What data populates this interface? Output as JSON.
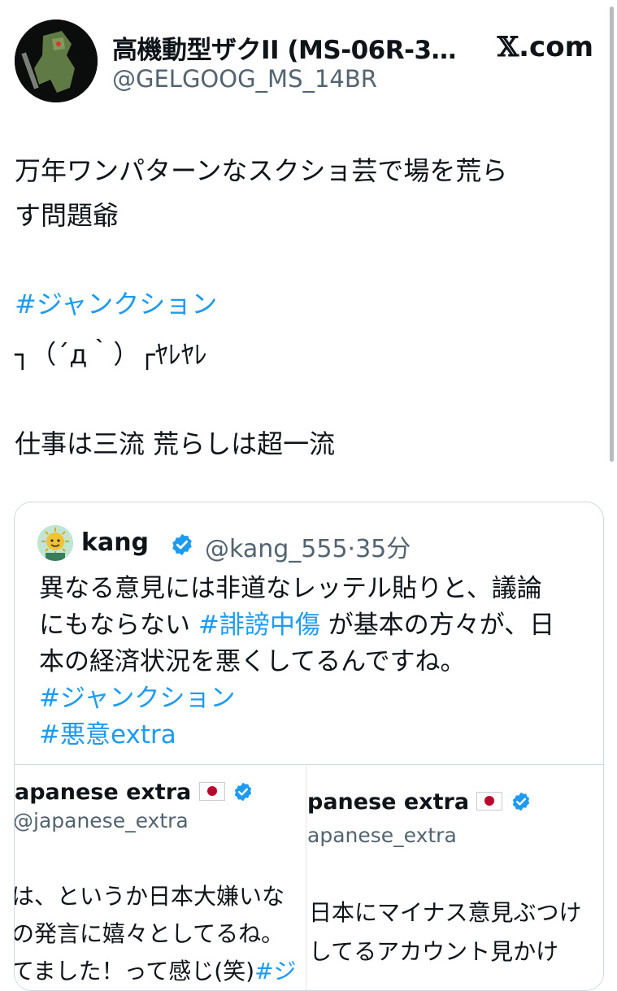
{
  "header": {
    "display_name": "高機動型ザクII (MS-06R-3…",
    "handle": "@GELGOOG_MS_14BR",
    "brand_logo": "𝕏",
    "brand_suffix": ".com"
  },
  "tweet": {
    "line1": "万年ワンパターンなスクショ芸で場を荒ら",
    "line2": "す問題爺",
    "hashtag": "#ジャンクション",
    "kaomoji": "┐（´д｀）┌ﾔﾚﾔﾚ",
    "line3": "仕事は三流 荒らしは超一流"
  },
  "quote": {
    "name": "kang",
    "handle": "@kang_555·35分",
    "line1": "異なる意見には非道なレッテル貼りと、議論",
    "line2_pre": "にもならない ",
    "line2_tag": "#誹謗中傷",
    "line2_post": " が基本の方々が、日",
    "line3": "本の経済状況を悪くしてるんですね。",
    "tag1": "#ジャンクション",
    "tag2": "#悪意extra"
  },
  "media": {
    "left": {
      "name": "apanese extra",
      "handle": "@japanese_extra",
      "line1": "は、というか日本大嫌いな",
      "line2": "の発言に嬉々としてるね。",
      "line3": "てました！って感じ(笑)",
      "line3_tag": "#ジ"
    },
    "right": {
      "corner": "ˇ",
      "name": "panese extra",
      "handle": "apanese_extra",
      "line1": "日本にマイナス意見ぶつけ",
      "line2": "してるアカウント見かけ"
    }
  },
  "colors": {
    "accent": "#1d9bf0",
    "verified": "#1d9bf0",
    "muted": "#536471",
    "border": "#cfd9de"
  },
  "icons": [
    "avatar-zaku",
    "verified-badge-icon",
    "japan-flag-icon",
    "x-logo-icon"
  ]
}
